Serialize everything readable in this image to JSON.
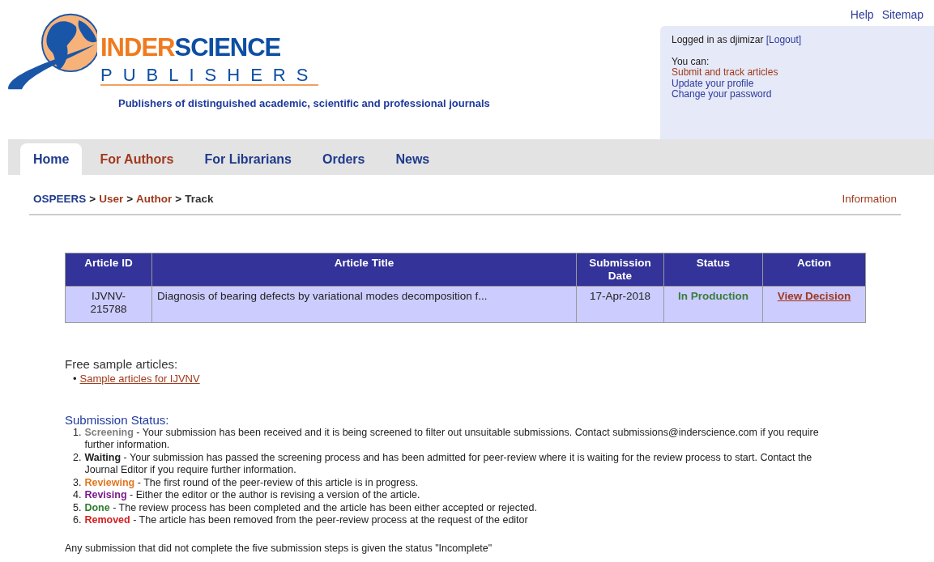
{
  "top_links": [
    "Help",
    "Sitemap"
  ],
  "logo": {
    "word_1": "INDER",
    "word_2": "SCIENCE",
    "word_3": "PUBLISHERS"
  },
  "tagline": "Publishers of distinguished academic, scientific and professional journals",
  "user_panel": {
    "logged_in_text": "Logged in as djimizar",
    "logout": "[Logout]",
    "you_can": "You can:",
    "links": [
      {
        "label": "Submit and track articles",
        "current": true
      },
      {
        "label": "Update your profile",
        "current": false
      },
      {
        "label": "Change your password",
        "current": false
      }
    ]
  },
  "tabs": [
    {
      "label": "Home",
      "selected": true,
      "highlighted": false
    },
    {
      "label": "For Authors",
      "selected": false,
      "highlighted": true
    },
    {
      "label": "For Librarians",
      "selected": false,
      "highlighted": false
    },
    {
      "label": "Orders",
      "selected": false,
      "highlighted": false
    },
    {
      "label": "News",
      "selected": false,
      "highlighted": false
    }
  ],
  "breadcrumb": [
    {
      "label": "OSPEERS",
      "kind": "root"
    },
    {
      "label": "User",
      "kind": "link"
    },
    {
      "label": "Author",
      "kind": "link"
    },
    {
      "label": "Track",
      "kind": "current"
    }
  ],
  "breadcrumb_separator": ">",
  "info_link": "Information",
  "table": {
    "columns": [
      "Article ID",
      "Article Title",
      "Submission Date",
      "Status",
      "Action"
    ],
    "rows": [
      {
        "id": "IJVNV-215788",
        "title": "Diagnosis of bearing defects by variational modes decomposition f...",
        "date": "17-Apr-2018",
        "status": "In Production",
        "action": "View Decision"
      }
    ]
  },
  "samples": {
    "heading": "Free sample articles:",
    "links": [
      {
        "marker": "•",
        "label": "Sample articles for IJVNV"
      }
    ]
  },
  "submission_status": {
    "heading": "Submission Status:",
    "items": [
      {
        "marker": "1.",
        "term": "Screening",
        "color": "#808080",
        "text": " - Your submission has been received and it is being screened to filter out unsuitable submissions. Contact submissions@inderscience.com if you require further information."
      },
      {
        "marker": "2.",
        "term": "Waiting",
        "color": "#222222",
        "text": " - Your submission has passed the screening process and has been admitted for peer-review where it is waiting for the review process to start. Contact the Journal Editor if you require further information."
      },
      {
        "marker": "3.",
        "term": "Reviewing",
        "color": "#e07820",
        "text": " - The first round of the peer-review of this article is in progress."
      },
      {
        "marker": "4.",
        "term": "Revising",
        "color": "#7a1a8c",
        "text": " - Either the editor or the author is revising a version of the article."
      },
      {
        "marker": "5.",
        "term": "Done",
        "color": "#2e7d32",
        "text": " - The review process has been completed and the article has been either accepted or rejected."
      },
      {
        "marker": "6.",
        "term": "Removed",
        "color": "#d42020",
        "text": " - The article has been removed from the peer-review process at the request of the editor"
      }
    ]
  },
  "footnote": "Any submission that did not complete the five submission steps is given the status \"Incomplete\""
}
